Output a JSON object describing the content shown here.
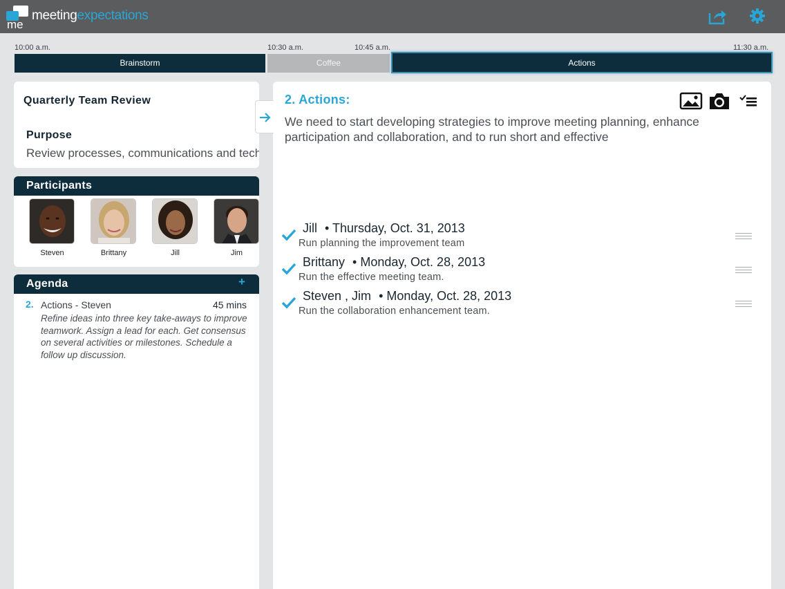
{
  "app": {
    "logo_part1": "meeting",
    "logo_part2": "expectations",
    "logo_mark": "me",
    "icons": {
      "share": "share-icon",
      "settings": "gear-icon"
    },
    "accent_color": "#2aa6d6",
    "dark_color": "#0e2d3c"
  },
  "timeline": {
    "labels": [
      "10:00 a.m.",
      "10:30 a.m.",
      "10:45 a.m.",
      "11:30 a.m."
    ],
    "segments": [
      {
        "label": "Brainstorm",
        "state": "normal"
      },
      {
        "label": "Coffee",
        "state": "break"
      },
      {
        "label": "Actions",
        "state": "selected"
      }
    ]
  },
  "meeting": {
    "title": "Quarterly Team Review",
    "purpose_heading": "Purpose",
    "purpose_text": "Review processes, communications and tech"
  },
  "participants": {
    "heading": "Participants",
    "people": [
      {
        "name": "Steven"
      },
      {
        "name": "Brittany"
      },
      {
        "name": "Jill"
      },
      {
        "name": "Jim"
      }
    ]
  },
  "agenda": {
    "heading": "Agenda",
    "add_label": "+",
    "item": {
      "number": "2.",
      "title": "Actions - Steven",
      "duration": "45 mins",
      "description": "Refine ideas into three key take-aways to improve teamwork.  Assign a lead for each.  Get consensus on several activities or milestones.  Schedule a follow up discussion."
    }
  },
  "main": {
    "title": "2. Actions:",
    "description": "We need to start developing strategies to improve meeting planning, enhance participation and collaboration, and to run short and effective",
    "toolbar_icons": [
      "image-icon",
      "camera-icon",
      "checklist-icon"
    ],
    "actions": [
      {
        "owner": "Jill",
        "date": "• Thursday, Oct. 31, 2013",
        "task": "Run planning the improvement team",
        "done": true
      },
      {
        "owner": "Brittany",
        "date": "• Monday, Oct. 28, 2013",
        "task": "Run the effective meeting team.",
        "done": true
      },
      {
        "owner": "Steven ,  Jim",
        "date": "• Monday, Oct. 28, 2013",
        "task": "Run the collaboration enhancement team.",
        "done": true
      }
    ]
  }
}
